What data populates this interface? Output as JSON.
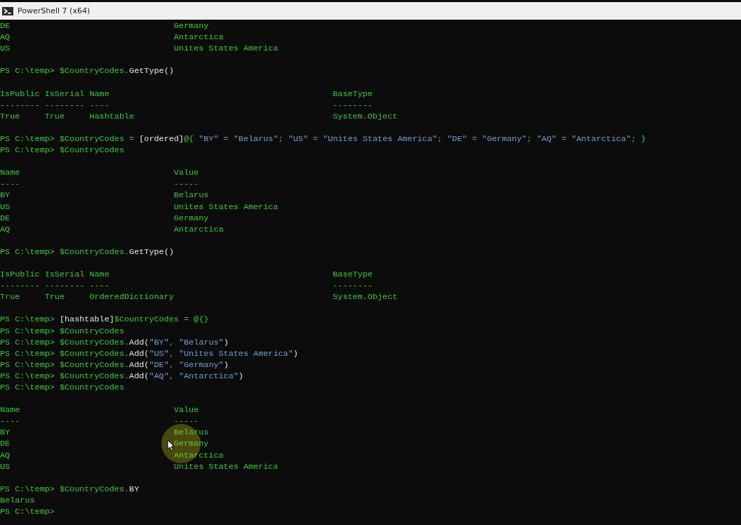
{
  "window": {
    "title": "PowerShell 7 (x64)"
  },
  "lines": [
    {
      "kind": "pair",
      "cells": [
        "DE",
        "Germany"
      ]
    },
    {
      "kind": "pair",
      "cells": [
        "AQ",
        "Antarctica"
      ]
    },
    {
      "kind": "pair",
      "cells": [
        "US",
        "Unites States America"
      ]
    },
    {
      "kind": "blank"
    },
    {
      "kind": "command",
      "prompt": "PS C:\\temp>",
      "segments": [
        {
          "kind": "var",
          "text": "$CountryCodes."
        },
        {
          "kind": "method",
          "text": "GetType()"
        }
      ]
    },
    {
      "kind": "blank"
    },
    {
      "kind": "type",
      "cells": [
        "IsPublic",
        "IsSerial",
        "Name",
        "BaseType"
      ]
    },
    {
      "kind": "type",
      "cells": [
        "--------",
        "--------",
        "----",
        "--------"
      ]
    },
    {
      "kind": "type",
      "cells": [
        "True",
        "True",
        "Hashtable",
        "System.Object"
      ]
    },
    {
      "kind": "blank"
    },
    {
      "kind": "command",
      "prompt": "PS C:\\temp>",
      "segments": [
        {
          "kind": "var",
          "text": "$CountryCodes"
        },
        {
          "kind": "op",
          "text": " = "
        },
        {
          "kind": "method",
          "text": "[ordered]"
        },
        {
          "kind": "var",
          "text": "@{ "
        },
        {
          "kind": "string",
          "text": "\"BY\""
        },
        {
          "kind": "op",
          "text": " = "
        },
        {
          "kind": "string",
          "text": "\"Belarus\""
        },
        {
          "kind": "var",
          "text": "; "
        },
        {
          "kind": "string",
          "text": "\"US\""
        },
        {
          "kind": "op",
          "text": " = "
        },
        {
          "kind": "string",
          "text": "\"Unites States America\""
        },
        {
          "kind": "var",
          "text": "; "
        },
        {
          "kind": "string",
          "text": "\"DE\""
        },
        {
          "kind": "op",
          "text": " = "
        },
        {
          "kind": "string",
          "text": "\"Germany\""
        },
        {
          "kind": "var",
          "text": "; "
        },
        {
          "kind": "string",
          "text": "\"AQ\""
        },
        {
          "kind": "op",
          "text": " = "
        },
        {
          "kind": "string",
          "text": "\"Antarctica\""
        },
        {
          "kind": "var",
          "text": "; }"
        }
      ]
    },
    {
      "kind": "command",
      "prompt": "PS C:\\temp>",
      "segments": [
        {
          "kind": "var",
          "text": "$CountryCodes"
        }
      ]
    },
    {
      "kind": "blank"
    },
    {
      "kind": "pair",
      "cells": [
        "Name",
        "Value"
      ]
    },
    {
      "kind": "pair",
      "cells": [
        "----",
        "-----"
      ]
    },
    {
      "kind": "pair",
      "cells": [
        "BY",
        "Belarus"
      ]
    },
    {
      "kind": "pair",
      "cells": [
        "US",
        "Unites States America"
      ]
    },
    {
      "kind": "pair",
      "cells": [
        "DE",
        "Germany"
      ]
    },
    {
      "kind": "pair",
      "cells": [
        "AQ",
        "Antarctica"
      ]
    },
    {
      "kind": "blank"
    },
    {
      "kind": "command",
      "prompt": "PS C:\\temp>",
      "segments": [
        {
          "kind": "var",
          "text": "$CountryCodes."
        },
        {
          "kind": "method",
          "text": "GetType()"
        }
      ]
    },
    {
      "kind": "blank"
    },
    {
      "kind": "type",
      "cells": [
        "IsPublic",
        "IsSerial",
        "Name",
        "BaseType"
      ]
    },
    {
      "kind": "type",
      "cells": [
        "--------",
        "--------",
        "----",
        "--------"
      ]
    },
    {
      "kind": "type",
      "cells": [
        "True",
        "True",
        "OrderedDictionary",
        "System.Object"
      ]
    },
    {
      "kind": "blank"
    },
    {
      "kind": "command",
      "prompt": "PS C:\\temp>",
      "segments": [
        {
          "kind": "method",
          "text": "[hashtable]"
        },
        {
          "kind": "var",
          "text": "$CountryCodes"
        },
        {
          "kind": "op",
          "text": " = "
        },
        {
          "kind": "var",
          "text": "@{}"
        }
      ]
    },
    {
      "kind": "command",
      "prompt": "PS C:\\temp>",
      "segments": [
        {
          "kind": "var",
          "text": "$CountryCodes"
        }
      ]
    },
    {
      "kind": "command",
      "prompt": "PS C:\\temp>",
      "segments": [
        {
          "kind": "var",
          "text": "$CountryCodes."
        },
        {
          "kind": "method",
          "text": "Add("
        },
        {
          "kind": "string",
          "text": "\"BY\""
        },
        {
          "kind": "op",
          "text": ", "
        },
        {
          "kind": "string",
          "text": "\"Belarus\""
        },
        {
          "kind": "method",
          "text": ")"
        }
      ]
    },
    {
      "kind": "command",
      "prompt": "PS C:\\temp>",
      "segments": [
        {
          "kind": "var",
          "text": "$CountryCodes."
        },
        {
          "kind": "method",
          "text": "Add("
        },
        {
          "kind": "string",
          "text": "\"US\""
        },
        {
          "kind": "op",
          "text": ", "
        },
        {
          "kind": "string",
          "text": "\"Unites States America\""
        },
        {
          "kind": "method",
          "text": ")"
        }
      ]
    },
    {
      "kind": "command",
      "prompt": "PS C:\\temp>",
      "segments": [
        {
          "kind": "var",
          "text": "$CountryCodes."
        },
        {
          "kind": "method",
          "text": "Add("
        },
        {
          "kind": "string",
          "text": "\"DE\""
        },
        {
          "kind": "op",
          "text": ", "
        },
        {
          "kind": "string",
          "text": "\"Germany\""
        },
        {
          "kind": "method",
          "text": ")"
        }
      ]
    },
    {
      "kind": "command",
      "prompt": "PS C:\\temp>",
      "segments": [
        {
          "kind": "var",
          "text": "$CountryCodes."
        },
        {
          "kind": "method",
          "text": "Add("
        },
        {
          "kind": "string",
          "text": "\"AQ\""
        },
        {
          "kind": "op",
          "text": ", "
        },
        {
          "kind": "string",
          "text": "\"Antarctica\""
        },
        {
          "kind": "method",
          "text": ")"
        }
      ]
    },
    {
      "kind": "command",
      "prompt": "PS C:\\temp>",
      "segments": [
        {
          "kind": "var",
          "text": "$CountryCodes"
        }
      ]
    },
    {
      "kind": "blank"
    },
    {
      "kind": "pair",
      "cells": [
        "Name",
        "Value"
      ]
    },
    {
      "kind": "pair",
      "cells": [
        "----",
        "-----"
      ]
    },
    {
      "kind": "pair",
      "cells": [
        "BY",
        "Belarus"
      ]
    },
    {
      "kind": "pair",
      "cells": [
        "DE",
        "Germany"
      ]
    },
    {
      "kind": "pair",
      "cells": [
        "AQ",
        "Antarctica"
      ]
    },
    {
      "kind": "pair",
      "cells": [
        "US",
        "Unites States America"
      ]
    },
    {
      "kind": "blank"
    },
    {
      "kind": "command",
      "prompt": "PS C:\\temp>",
      "segments": [
        {
          "kind": "var",
          "text": "$CountryCodes."
        },
        {
          "kind": "method",
          "text": "BY"
        }
      ]
    },
    {
      "kind": "output",
      "text": "Belarus"
    },
    {
      "kind": "command",
      "prompt": "PS C:\\temp>"
    }
  ]
}
